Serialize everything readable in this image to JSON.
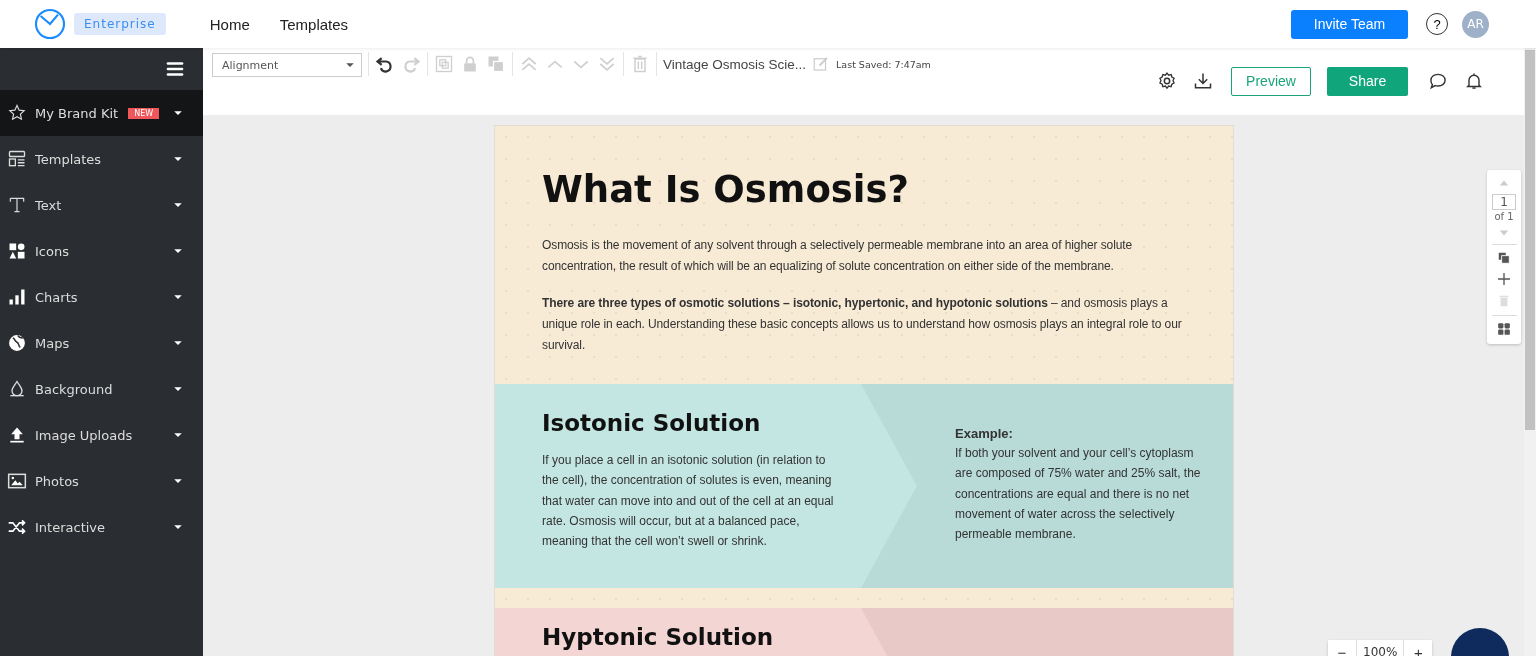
{
  "topbar": {
    "plan_badge": "Enterprise",
    "nav": [
      {
        "label": "Home"
      },
      {
        "label": "Templates"
      }
    ],
    "invite_button": "Invite Team",
    "help": "?",
    "avatar": "AR"
  },
  "sidebar": {
    "items": [
      {
        "label": "My Brand Kit",
        "badge": "NEW",
        "selected": true
      },
      {
        "label": "Templates",
        "selected": false
      },
      {
        "label": "Text",
        "selected": false
      },
      {
        "label": "Icons",
        "selected": false
      },
      {
        "label": "Charts",
        "selected": false
      },
      {
        "label": "Maps",
        "selected": false
      },
      {
        "label": "Background",
        "selected": false
      },
      {
        "label": "Image Uploads",
        "selected": false
      },
      {
        "label": "Photos",
        "selected": false
      },
      {
        "label": "Interactive",
        "selected": false
      }
    ]
  },
  "toolbar": {
    "alignment": "Alignment",
    "tools": [
      {
        "disabled": false
      },
      {
        "disabled": true
      },
      {
        "disabled": true
      },
      {
        "disabled": true
      },
      {
        "disabled": true
      },
      {
        "disabled": true
      },
      {
        "disabled": true
      },
      {
        "disabled": true
      },
      {
        "disabled": true
      },
      {
        "disabled": true
      }
    ],
    "document_title": "Vintage Osmosis Scie...",
    "last_saved": "Last Saved: 7:47am",
    "preview_button": "Preview",
    "share_button": "Share"
  },
  "document": {
    "title": "What Is Osmosis?",
    "paragraphs": [
      "Osmosis is the movement of any solvent through a selectively permeable membrane into an area of higher solute concentration, the result of which will be an equalizing of solute concentration on either side of the membrane.",
      "**There are three types of osmotic solutions – isotonic, hypertonic, and hypotonic solutions** – and osmosis plays a unique role in each. Understanding these basic concepts allows us to understand how osmosis plays an integral role to our survival."
    ],
    "sections": [
      {
        "kind": "teal",
        "heading": "Isotonic Solution",
        "body": "If you place a cell in an isotonic solution (in relation to the cell), the concentration of solutes is even, meaning that water can move into and out of the cell at an equal rate. Osmosis will occur, but at a balanced pace, meaning that the cell won’t swell or shrink.",
        "example_label": "Example:",
        "example": "If both your solvent and your cell’s cytoplasm are composed of 75% water and 25% salt, the concentrations are equal and there is no net movement of water across the selectively permeable membrane."
      },
      {
        "kind": "pink",
        "heading": "Hyptonic Solution"
      }
    ]
  },
  "page_panel": {
    "page": "1",
    "of": "of 1"
  },
  "zoom": {
    "minus": "−",
    "value": "100%",
    "plus": "+"
  }
}
